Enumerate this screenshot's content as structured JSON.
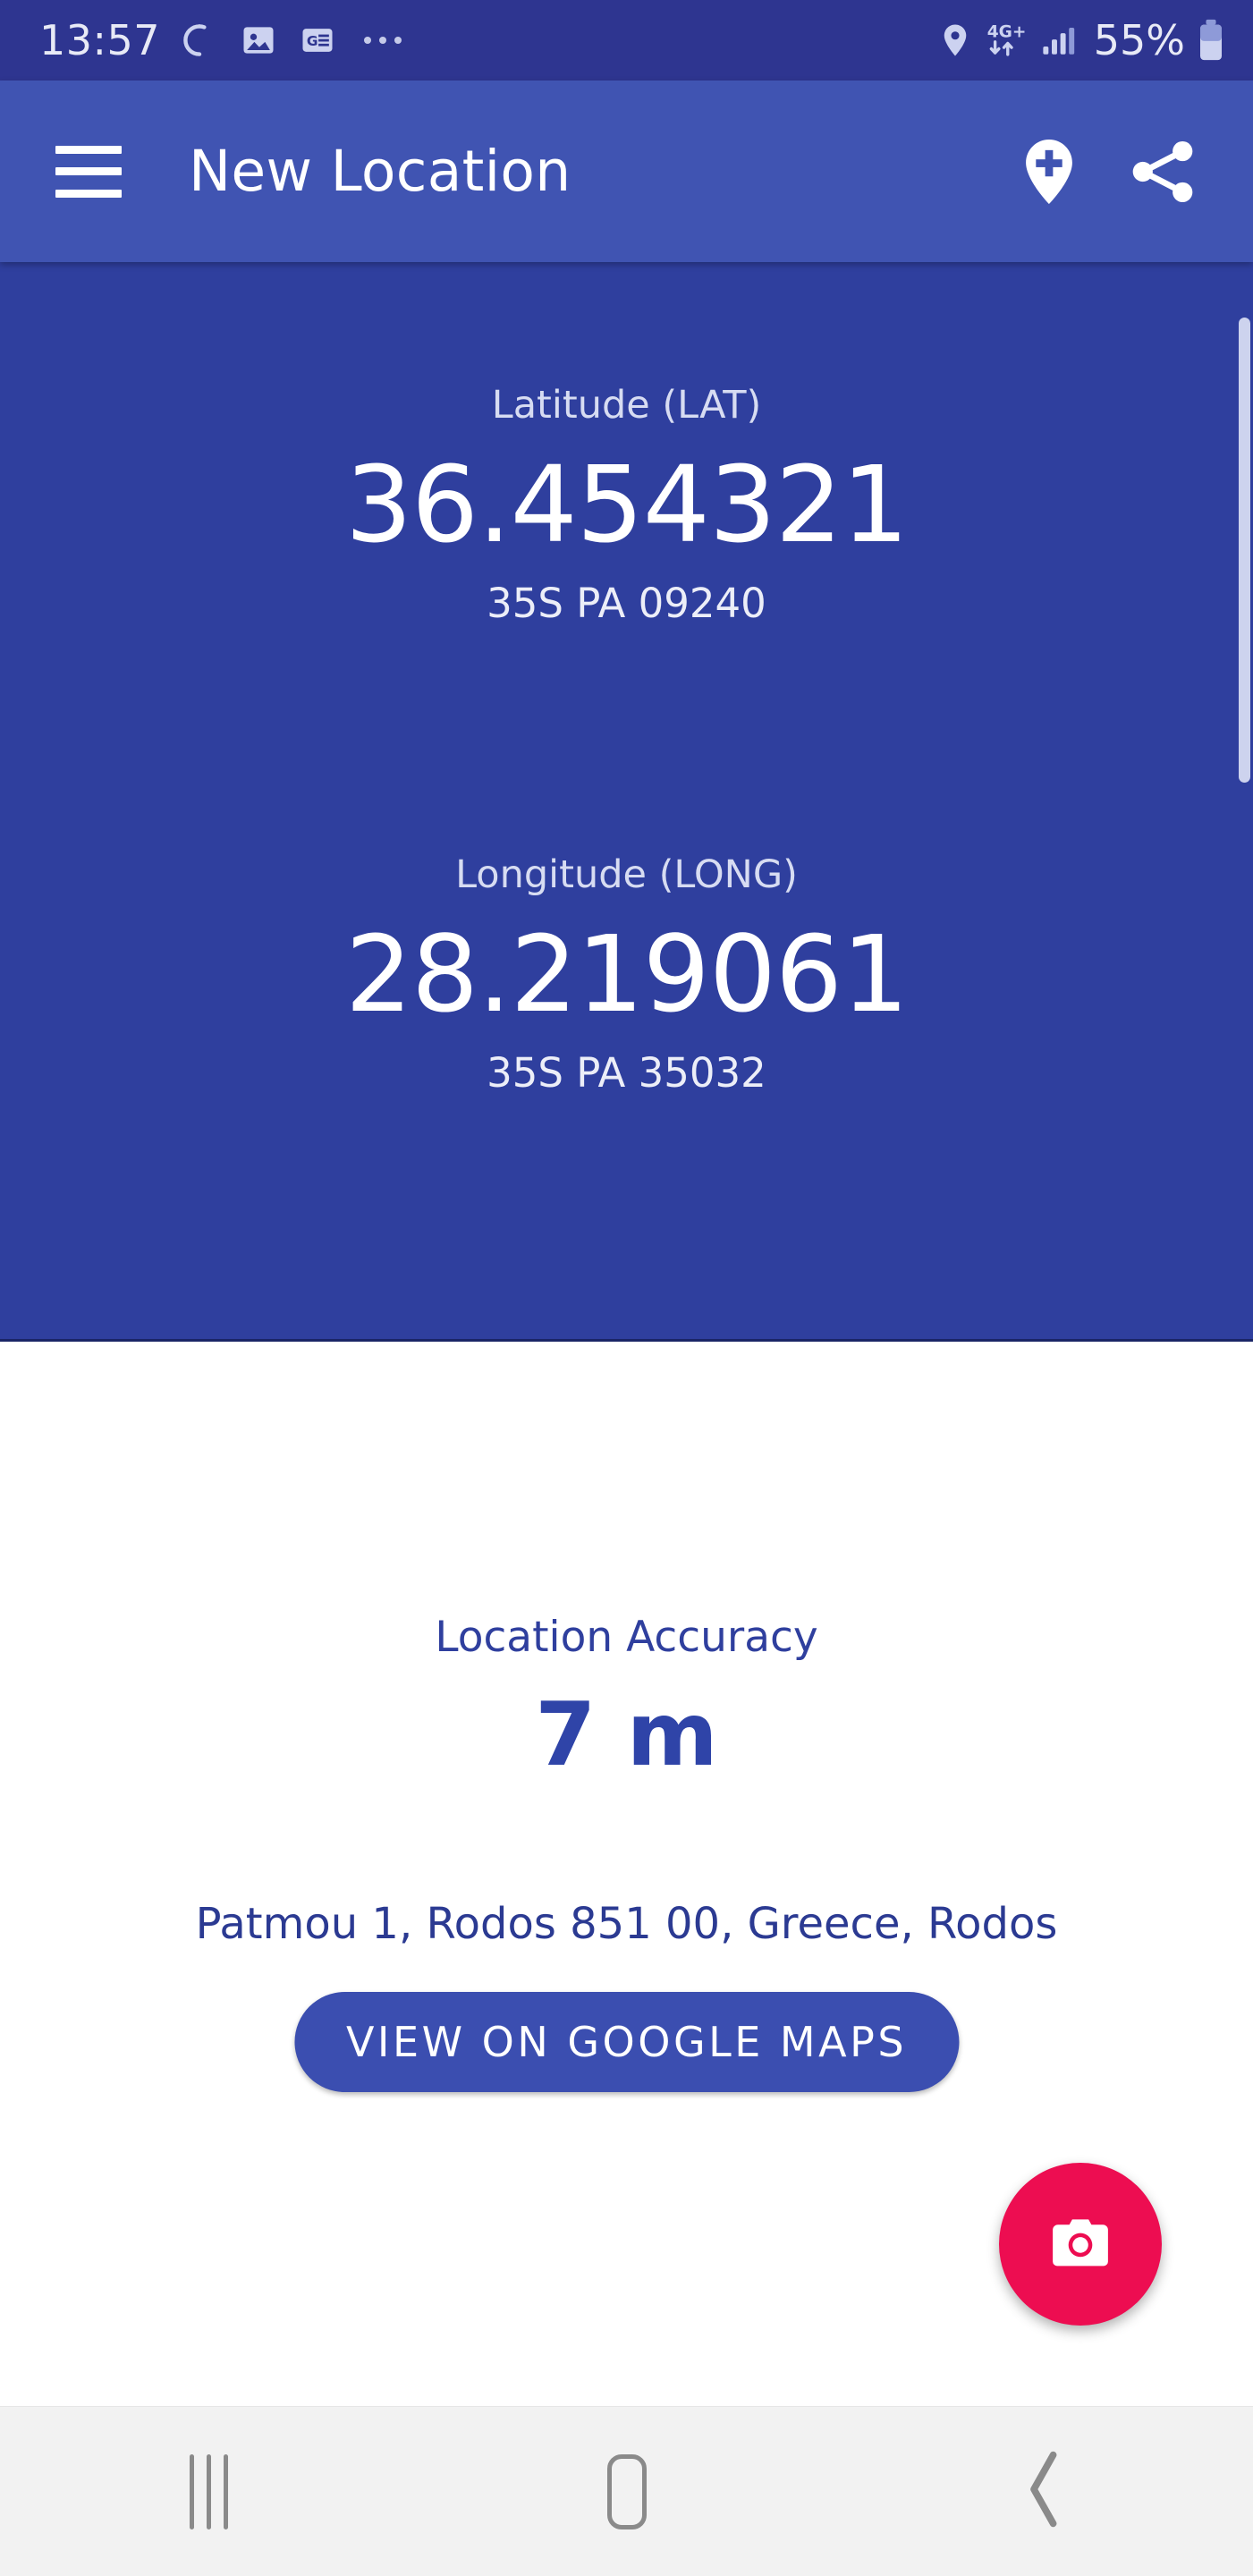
{
  "status_bar": {
    "time": "13:57",
    "icons_left": [
      "sync-icon",
      "image-icon",
      "google-news-icon",
      "more-dots-icon"
    ],
    "network_type": "4G+",
    "battery_percent": "55%",
    "icons_right": [
      "location-pin-icon",
      "data-transfer-icon",
      "signal-bars-icon",
      "battery-icon"
    ],
    "background_color": "#2e3590"
  },
  "app_bar": {
    "title": "New Location",
    "menu_icon": "hamburger-menu-icon",
    "add_location_icon": "add-location-pin-icon",
    "share_icon": "share-icon",
    "background_color": "#4054b2"
  },
  "coordinates": {
    "background_color": "#2f3f9e",
    "latitude": {
      "label": "Latitude (LAT)",
      "value": "36.454321",
      "mgrs": "35S PA 09240"
    },
    "longitude": {
      "label": "Longitude (LONG)",
      "value": "28.219061",
      "mgrs": "35S PA 35032"
    }
  },
  "accuracy": {
    "label": "Location Accuracy",
    "value": "7 m",
    "accent_color": "#2f44a8"
  },
  "address": {
    "text": "Patmou 1, Rodos 851 00, Greece, Rodos"
  },
  "maps_button": {
    "label": "VIEW ON GOOGLE MAPS",
    "background_color": "#3b4eb0"
  },
  "fab": {
    "icon": "camera-icon",
    "background_color": "#ed0d51"
  },
  "nav_bar": {
    "recents_icon": "recents-icon",
    "home_icon": "home-icon",
    "back_icon": "back-icon",
    "background_color": "#f2f2f2"
  }
}
